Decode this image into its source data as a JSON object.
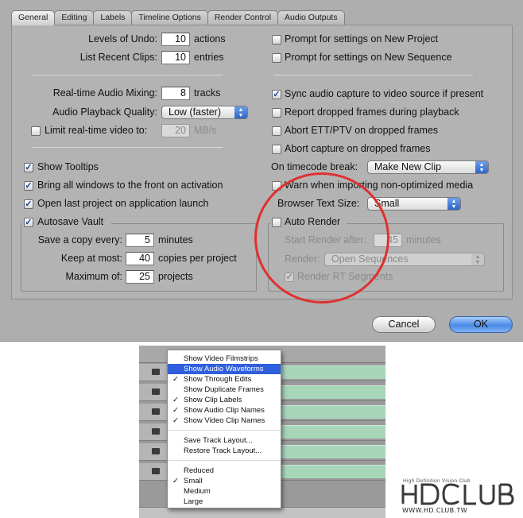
{
  "tabs": [
    "General",
    "Editing",
    "Labels",
    "Timeline Options",
    "Render Control",
    "Audio Outputs"
  ],
  "left": {
    "levels_of_undo_label": "Levels of Undo:",
    "levels_of_undo_value": "10",
    "levels_of_undo_unit": "actions",
    "recent_clips_label": "List Recent Clips:",
    "recent_clips_value": "10",
    "recent_clips_unit": "entries",
    "audio_mixing_label": "Real-time Audio Mixing:",
    "audio_mixing_value": "8",
    "audio_mixing_unit": "tracks",
    "playback_quality_label": "Audio Playback Quality:",
    "playback_quality_value": "Low (faster)",
    "limit_video_label": "Limit real-time video to:",
    "limit_video_value": "20",
    "limit_video_unit": "MB/s",
    "show_tooltips": "Show Tooltips",
    "bring_windows": "Bring all windows to the front on activation",
    "open_last_project": "Open last project on application launch",
    "autosave_label": "Autosave Vault",
    "save_copy_label": "Save a copy every:",
    "save_copy_value": "5",
    "save_copy_unit": "minutes",
    "keep_most_label": "Keep at most:",
    "keep_most_value": "40",
    "keep_most_unit": "copies per project",
    "maximum_label": "Maximum of:",
    "maximum_value": "25",
    "maximum_unit": "projects"
  },
  "right": {
    "prompt_new_project": "Prompt for settings on New Project",
    "prompt_new_sequence": "Prompt for settings on New Sequence",
    "sync_audio": "Sync audio capture to video source if present",
    "report_dropped": "Report dropped frames during playback",
    "abort_ett": "Abort ETT/PTV on dropped frames",
    "abort_capture": "Abort capture on dropped frames",
    "timecode_break_label": "On timecode break:",
    "timecode_break_value": "Make New Clip",
    "warn_importing": "Warn when importing non-optimized media",
    "browser_text_label": "Browser Text Size:",
    "browser_text_value": "Small",
    "auto_render_label": "Auto Render",
    "start_render_label": "Start Render after:",
    "start_render_value": "45",
    "start_render_unit": "minutes",
    "render_label": "Render:",
    "render_value": "Open Sequences",
    "render_rt_segments": "Render RT Segments"
  },
  "buttons": {
    "cancel": "Cancel",
    "ok": "OK"
  },
  "menu": {
    "items": [
      {
        "label": "Show Video Filmstrips",
        "checked": false,
        "highlighted": false
      },
      {
        "label": "Show Audio Waveforms",
        "checked": false,
        "highlighted": true
      },
      {
        "label": "Show Through Edits",
        "checked": true,
        "highlighted": false
      },
      {
        "label": "Show Duplicate Frames",
        "checked": false,
        "highlighted": false
      },
      {
        "label": "Show Clip Labels",
        "checked": true,
        "highlighted": false
      },
      {
        "label": "Show Audio Clip Names",
        "checked": true,
        "highlighted": false
      },
      {
        "label": "Show Video Clip Names",
        "checked": true,
        "highlighted": false
      }
    ],
    "layout_items": [
      "Save Track Layout...",
      "Restore Track Layout..."
    ],
    "size_items": [
      {
        "label": "Reduced",
        "checked": false
      },
      {
        "label": "Small",
        "checked": true
      },
      {
        "label": "Medium",
        "checked": false
      },
      {
        "label": "Large",
        "checked": false
      }
    ],
    "check_glyph": "✓"
  },
  "logo": {
    "tagline": "High Definition Vision Club",
    "url": "WWW.HD.CLUB.TW",
    "colors": {
      "circle": "#e03030",
      "highlight": "#2f5fdc",
      "clip": "#a8d6b8"
    }
  }
}
